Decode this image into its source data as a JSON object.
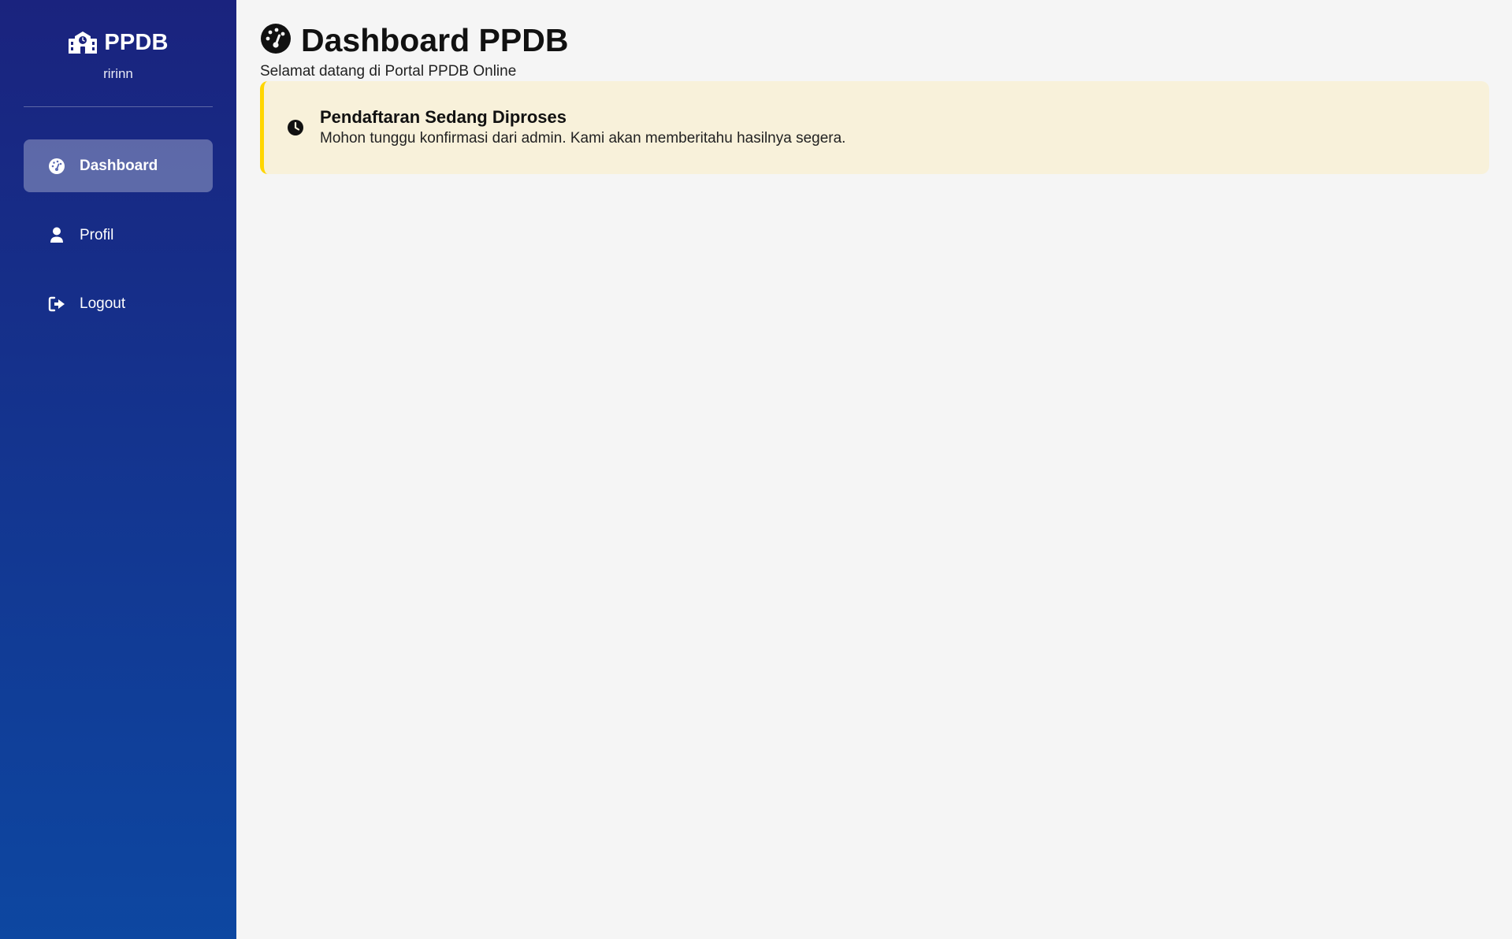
{
  "sidebar": {
    "brand": {
      "icon": "school-icon",
      "title": "PPDB"
    },
    "username": "ririnn",
    "nav": [
      {
        "label": "Dashboard",
        "icon": "gauge-icon",
        "active": true
      },
      {
        "label": "Profil",
        "icon": "user-icon",
        "active": false
      },
      {
        "label": "Logout",
        "icon": "logout-icon",
        "active": false
      }
    ]
  },
  "main": {
    "title": "Dashboard PPDB",
    "title_icon": "gauge-icon",
    "subtitle": "Selamat datang di Portal PPDB Online",
    "alert": {
      "icon": "clock-icon",
      "title": "Pendaftaran Sedang Diproses",
      "message": "Mohon tunggu konfirmasi dari admin. Kami akan memberitahu hasilnya segera.",
      "accent_color": "#ffd600",
      "background_color": "#f8f1da"
    }
  },
  "colors": {
    "sidebar_gradient_top": "#1a237e",
    "sidebar_gradient_bottom": "#0d47a1",
    "page_background": "#f5f5f5"
  }
}
